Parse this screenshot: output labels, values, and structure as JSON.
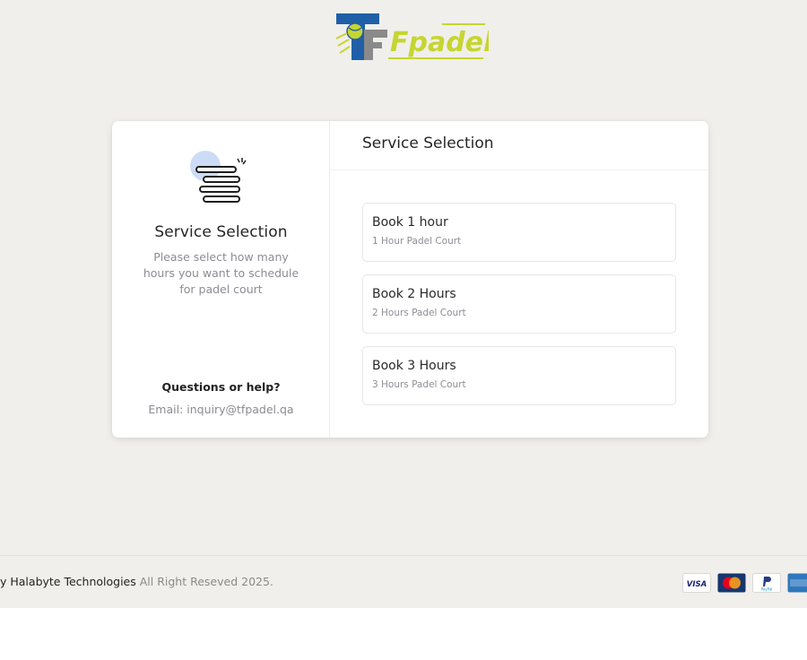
{
  "logo": {
    "text": "Fpadel",
    "accent": "#c6d531",
    "blue": "#1f5fa8",
    "gray": "#8a8a8a"
  },
  "left_panel": {
    "title": "Service Selection",
    "description": "Please select how many hours you want to schedule for padel court",
    "help_title": "Questions or help?",
    "email": "Email: inquiry@tfpadel.qa"
  },
  "right_panel": {
    "header": "Service Selection",
    "options": [
      {
        "name": "Book 1 hour",
        "subtitle": "1 Hour Padel Court"
      },
      {
        "name": "Book 2 Hours",
        "subtitle": "2 Hours Padel Court"
      },
      {
        "name": "Book 3 Hours",
        "subtitle": "3 Hours Padel Court"
      }
    ]
  },
  "footer": {
    "brand": "y Halabyte Technologies",
    "rights": " All Right Reseved 2025.",
    "payment_icons": [
      "visa-icon",
      "mastercard-icon",
      "paypal-icon",
      "amex-icon"
    ],
    "visa_label": "VISA",
    "paypal_label": "PayPal"
  }
}
